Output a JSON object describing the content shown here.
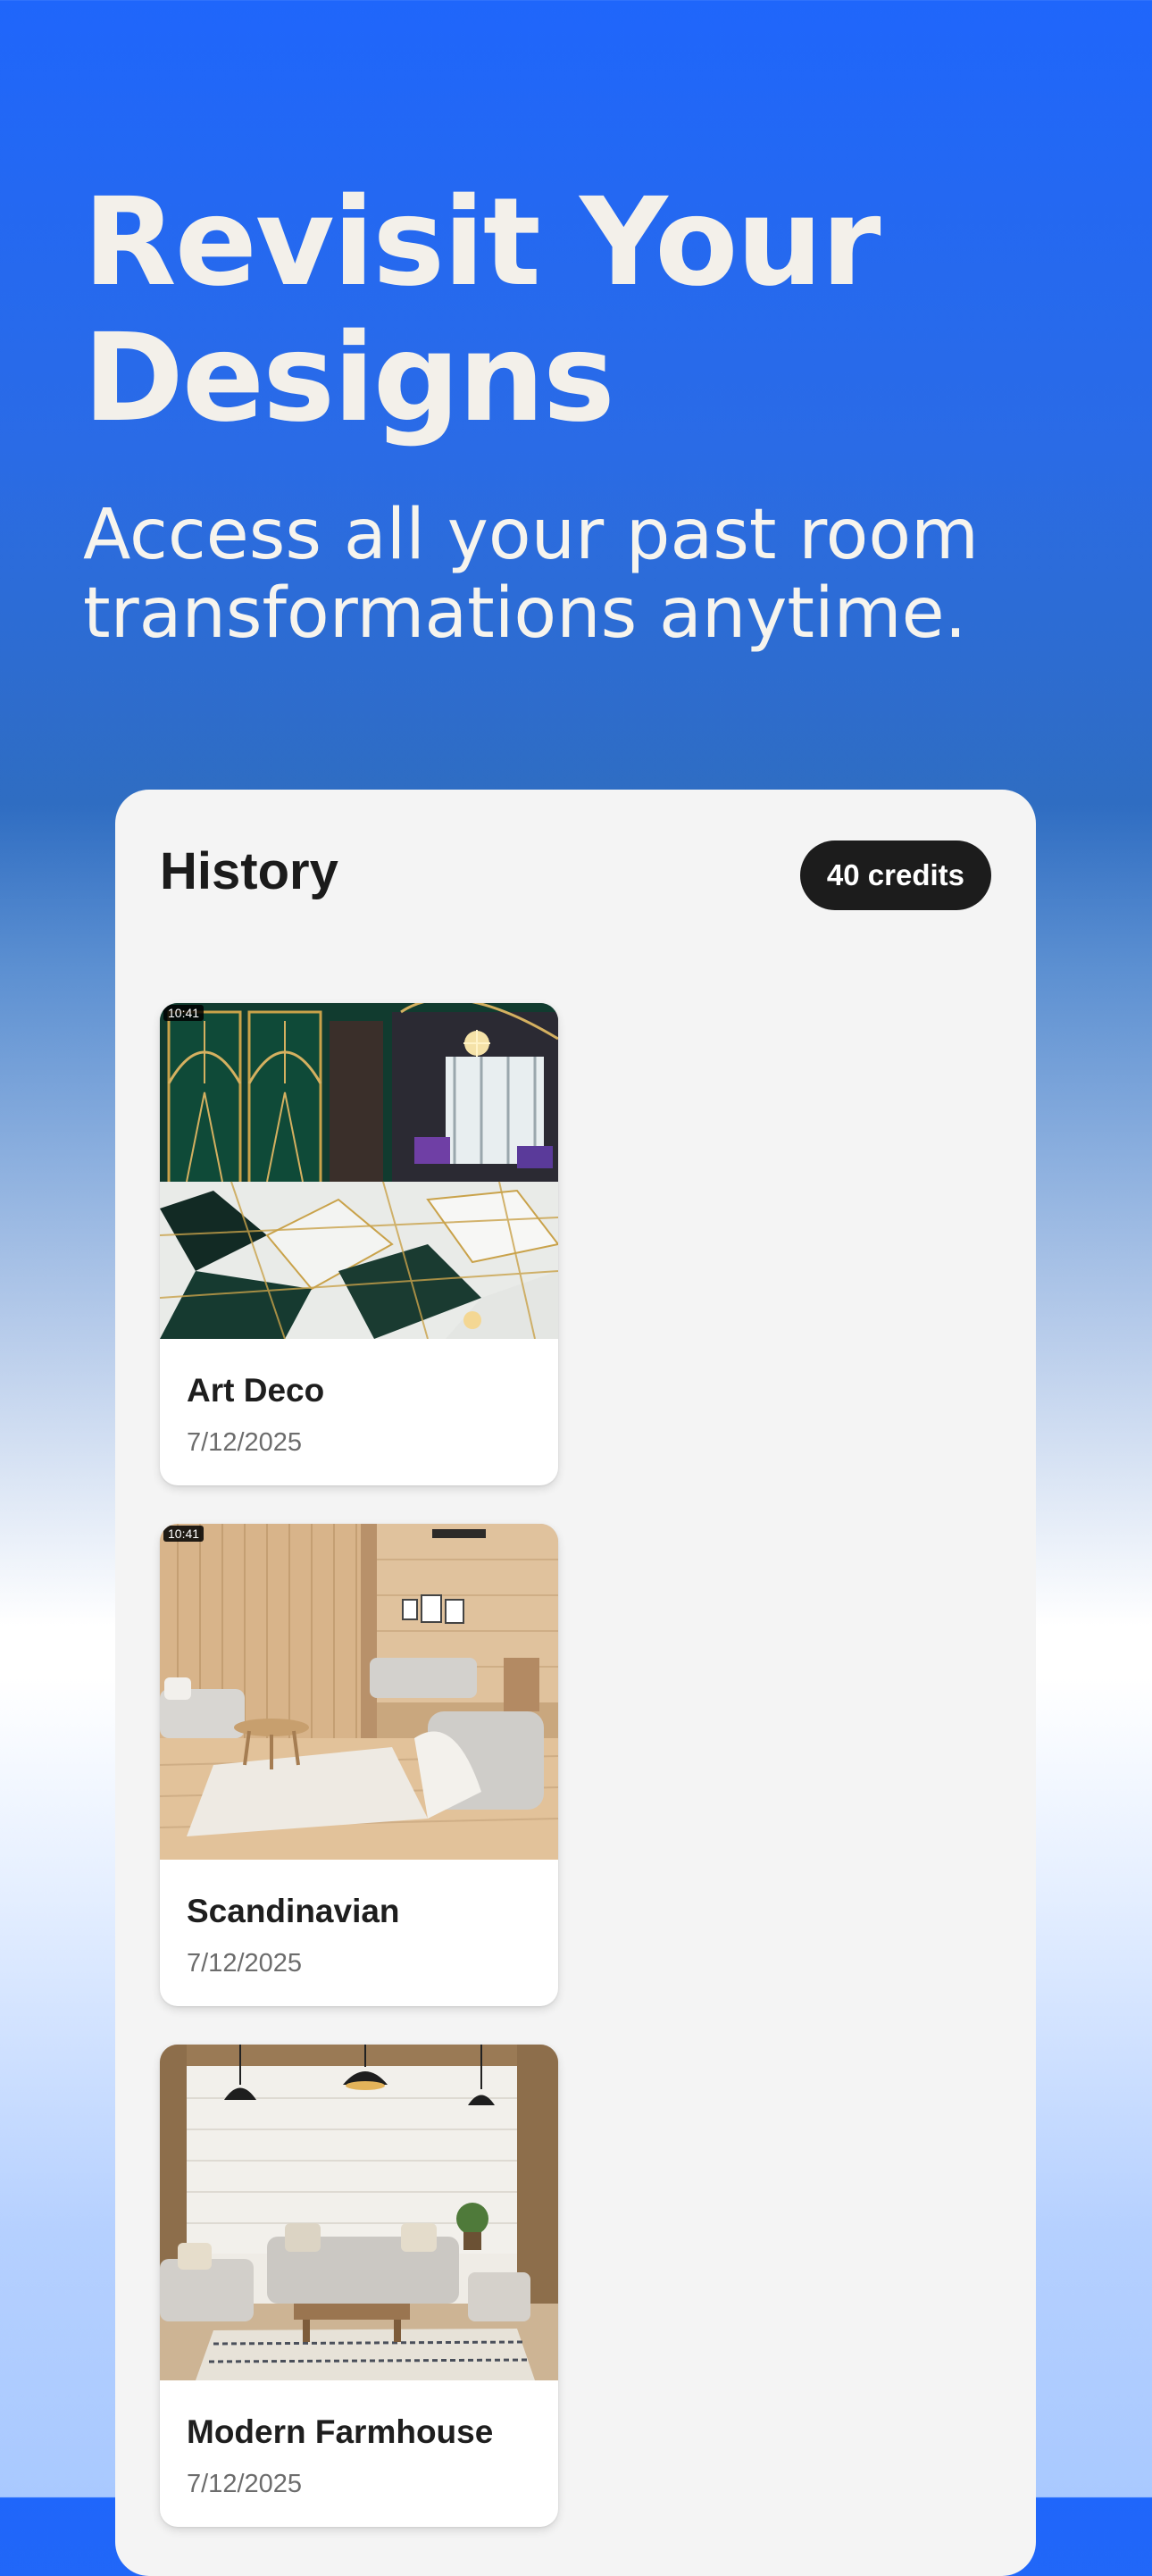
{
  "hero": {
    "title": "Revisit Your Designs",
    "subtitle": "Access all your past room transformations anytime."
  },
  "history": {
    "title": "History",
    "credits": "40 credits",
    "items": [
      {
        "title": "Art Deco",
        "date": "7/12/2025",
        "time_tag": "10:41",
        "image": "art-deco-interior"
      },
      {
        "title": "Scandinavian",
        "date": "7/12/2025",
        "time_tag": "10:41",
        "image": "scandinavian-living-room"
      },
      {
        "title": "Modern Farmhouse",
        "date": "7/12/2025",
        "time_tag": "",
        "image": "modern-farmhouse-living-room"
      }
    ]
  },
  "colors": {
    "gradient_top": "#1f66fb",
    "panel_background": "#f4f4f4",
    "badge_background": "#1c1c1c",
    "hero_text": "#f3f0ea"
  }
}
